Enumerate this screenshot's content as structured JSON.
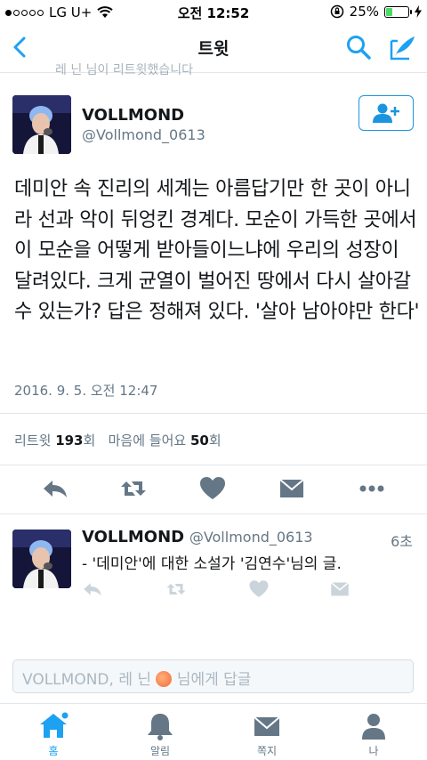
{
  "status": {
    "carrier": "LG U+",
    "time": "오전 12:52",
    "battery": "25%",
    "battery_level": 0.25
  },
  "nav": {
    "title": "트윗",
    "back_icon": "chevron-left-icon",
    "search_icon": "search-icon",
    "compose_icon": "compose-tweet-icon"
  },
  "retweet_context": "레 닌 님이 리트윗했습니다",
  "tweet": {
    "name": "VOLLMOND",
    "handle": "@Vollmond_0613",
    "text": "데미안 속 진리의 세계는 아름답기만 한 곳이 아니라 선과 악이 뒤엉킨 경계다. 모순이 가득한 곳에서 이 모순을 어떻게 받아들이느냐에 우리의 성장이 달려있다. 크게 균열이 벌어진 땅에서 다시 살아갈 수 있는가? 답은 정해져 있다. '살아 남아야만 한다'",
    "timestamp": "2016. 9. 5. 오전 12:47",
    "retweet_label": "리트윗",
    "retweet_count": "193",
    "retweet_unit": "회",
    "like_label": "마음에 들어요",
    "like_count": "50",
    "like_unit": "회"
  },
  "reply": {
    "name": "VOLLMOND",
    "handle": "@Vollmond_0613",
    "age": "6초",
    "text": "- '데미안'에 대한 소설가 '김연수'님의 글."
  },
  "reply_box": {
    "prefix": "VOLLMOND, 레 닌",
    "suffix": "님에게 답글"
  },
  "tabs": [
    {
      "label": "홈",
      "icon": "home-icon",
      "active": true
    },
    {
      "label": "알림",
      "icon": "bell-icon",
      "active": false
    },
    {
      "label": "쪽지",
      "icon": "envelope-icon",
      "active": false
    },
    {
      "label": "나",
      "icon": "person-icon",
      "active": false
    }
  ],
  "colors": {
    "accent": "#1da1f2",
    "action_gray": "#657786",
    "battery_green": "#4cd964"
  }
}
